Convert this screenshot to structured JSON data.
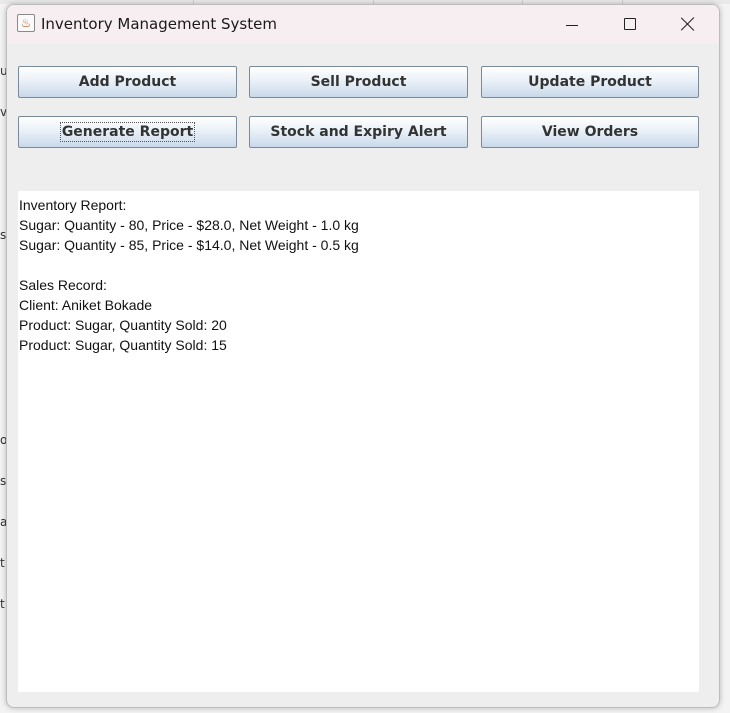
{
  "window": {
    "title": "Inventory Management System",
    "controls": [
      "minimize-icon",
      "maximize-icon",
      "close-icon"
    ]
  },
  "buttons": {
    "add_product": "Add Product",
    "sell_product": "Sell Product",
    "update_product": "Update Product",
    "generate_report": "Generate Report",
    "stock_expiry_alert": "Stock and Expiry Alert",
    "view_orders": "View Orders"
  },
  "report": {
    "lines": [
      "Inventory Report:",
      "Sugar: Quantity - 80, Price - $28.0, Net Weight - 1.0 kg",
      "Sugar: Quantity - 85, Price - $14.0, Net Weight - 0.5 kg",
      "",
      "Sales Record:",
      "Client: Aniket Bokade",
      "Product: Sugar, Quantity Sold: 20",
      "Product: Sugar, Quantity Sold: 15"
    ]
  },
  "background_fragments": [
    "us",
    "va",
    "s",
    "o",
    "s:",
    "a",
    "t.",
    "t."
  ]
}
